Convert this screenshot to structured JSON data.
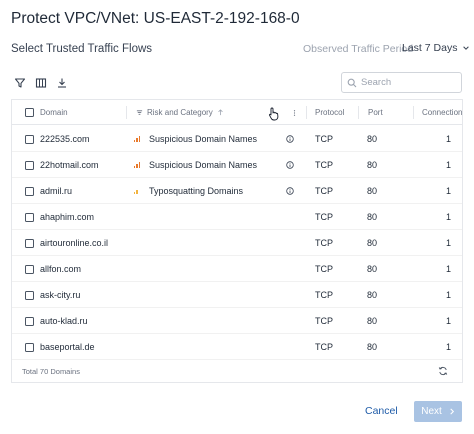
{
  "dialog": {
    "title": "Protect VPC/VNet: US-EAST-2-192-168-0",
    "subtitle": "Select Trusted Traffic Flows",
    "period_label": "Observed Traffic Period",
    "period_value": "Last 7 Days"
  },
  "toolbar": {
    "icons": [
      "filter-icon",
      "columns-icon",
      "download-icon"
    ],
    "search_placeholder": "Search"
  },
  "table": {
    "columns": {
      "domain": "Domain",
      "risk": "Risk and Category",
      "protocol": "Protocol",
      "port": "Port",
      "connections": "Connections"
    },
    "rows": [
      {
        "domain": "222535.com",
        "risk_level": "high",
        "category": "Suspicious Domain Names",
        "info": true,
        "protocol": "TCP",
        "port": "80",
        "connections": "1"
      },
      {
        "domain": "22hotmail.com",
        "risk_level": "high",
        "category": "Suspicious Domain Names",
        "info": true,
        "protocol": "TCP",
        "port": "80",
        "connections": "1"
      },
      {
        "domain": "admil.ru",
        "risk_level": "medium",
        "category": "Typosquatting Domains",
        "info": true,
        "protocol": "TCP",
        "port": "80",
        "connections": "1"
      },
      {
        "domain": "ahaphim.com",
        "risk_level": "",
        "category": "",
        "info": false,
        "protocol": "TCP",
        "port": "80",
        "connections": "1"
      },
      {
        "domain": "airtouronline.co.il",
        "risk_level": "",
        "category": "",
        "info": false,
        "protocol": "TCP",
        "port": "80",
        "connections": "1"
      },
      {
        "domain": "allfon.com",
        "risk_level": "",
        "category": "",
        "info": false,
        "protocol": "TCP",
        "port": "80",
        "connections": "1"
      },
      {
        "domain": "ask-city.ru",
        "risk_level": "",
        "category": "",
        "info": false,
        "protocol": "TCP",
        "port": "80",
        "connections": "1"
      },
      {
        "domain": "auto-klad.ru",
        "risk_level": "",
        "category": "",
        "info": false,
        "protocol": "TCP",
        "port": "80",
        "connections": "1"
      },
      {
        "domain": "baseportal.de",
        "risk_level": "",
        "category": "",
        "info": false,
        "protocol": "TCP",
        "port": "80",
        "connections": "1"
      }
    ],
    "total_text": "Total 70 Domains"
  },
  "footer": {
    "cancel_label": "Cancel",
    "next_label": "Next"
  },
  "colors": {
    "accent": "#1e5ba8",
    "next_disabled": "#a9c3e3",
    "risk_high": "#e8792b",
    "risk_medium": "#f2b441"
  }
}
